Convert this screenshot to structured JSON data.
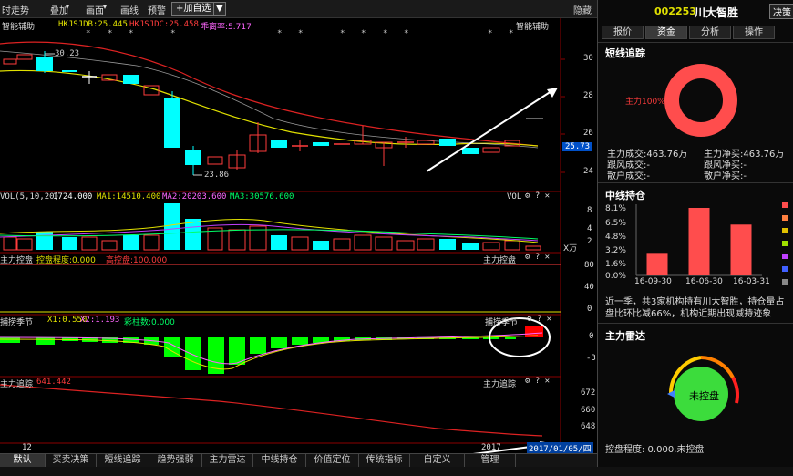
{
  "toolbar": {
    "items": [
      "时走势",
      "叠加",
      "画面",
      "画线",
      "预警"
    ],
    "add_button": "+加自选",
    "hide_label": "隐藏"
  },
  "chart": {
    "title": "智能辅助",
    "title_right": "智能辅助",
    "indicators": {
      "hkjsjdb": "HKJSJDB:25.445",
      "hkjsjdc": "HKJSJDC:25.458",
      "deviation": "乖离率:5.717"
    },
    "price_ticks": [
      "30",
      "28",
      "26",
      "24"
    ],
    "current_price": "25.73",
    "high_label": "30.23",
    "low_label": "23.86",
    "vol_header": {
      "name": "VOL(5,10,20)",
      "value": "1724.000",
      "ma1": "MA1:14510.400",
      "ma2": "MA2:20203.600",
      "ma3": "MA3:30576.600",
      "right": "VOL"
    },
    "vol_ticks": [
      "8",
      "4",
      "2"
    ],
    "vol_unit": "X万",
    "zkp_header": {
      "name": "主力控盘",
      "degree": "控盘程度:0.000",
      "high": "高控盘:100.000",
      "right": "主力控盘"
    },
    "zkp_ticks": [
      "80",
      "40",
      "0"
    ],
    "bzjj_header": {
      "name": "捕捞季节",
      "x1": "X1:0.550",
      "x2": "X2:1.193",
      "bars": "彩柱数:0.000",
      "right": "捕捞季节"
    },
    "bzjj_ticks": [
      "0",
      "-3"
    ],
    "zlzz_header": {
      "name": "主力追踪",
      "value": "641.442",
      "right": "主力追踪"
    },
    "zlzz_ticks": [
      "672",
      "660",
      "648"
    ],
    "date_label": "2017/01/05/四",
    "year_label": "2017",
    "month_label": "12"
  },
  "tabs": [
    "默认",
    "买卖决策",
    "短线追踪",
    "趋势强弱",
    "主力雷达",
    "中线持仓",
    "价值定位",
    "传统指标",
    "自定义",
    "管理"
  ],
  "right_panel": {
    "stock_code": "002253",
    "stock_name": "川大智胜",
    "buy_sell_button": "决策",
    "tabs": [
      "报价",
      "资金",
      "分析",
      "操作"
    ],
    "short_track": {
      "title": "短线追踪",
      "donut_label": "主力100%",
      "rows": [
        [
          "主力成交:463.76万",
          "主力净买:463.76万"
        ],
        [
          "跟风成交:-",
          "跟风净买:-"
        ],
        [
          "散户成交:-",
          "散户净买:-"
        ]
      ]
    },
    "mid_hold": {
      "title": "中线持仓",
      "y_ticks": [
        "8.1%",
        "6.5%",
        "4.8%",
        "3.2%",
        "1.6%",
        "0.0%"
      ],
      "x_labels": [
        "16-09-30",
        "16-06-30",
        "16-03-31"
      ],
      "desc_line1": "近一季，共3家机构持有川大智胜，持仓量占",
      "desc_line2": "盘比环比减66%，机构近期出现减持迹象"
    },
    "radar": {
      "title": "主力雷达",
      "center_label": "未控盘",
      "degree_text": "控盘程度: 0.000,未控盘"
    }
  },
  "chart_data": [
    {
      "type": "bar",
      "title": "中线持仓",
      "categories": [
        "16-09-30",
        "16-06-30",
        "16-03-31"
      ],
      "values": [
        2.7,
        8.1,
        6.1
      ],
      "ylim": [
        0,
        8.1
      ]
    }
  ],
  "colors": {
    "up": "#ff3c3c",
    "down": "#00ffff",
    "ma_yellow": "#e0e000",
    "ma_red": "#dd2222",
    "macd_green": "#00ff00",
    "accent_blue": "#0050c8"
  }
}
